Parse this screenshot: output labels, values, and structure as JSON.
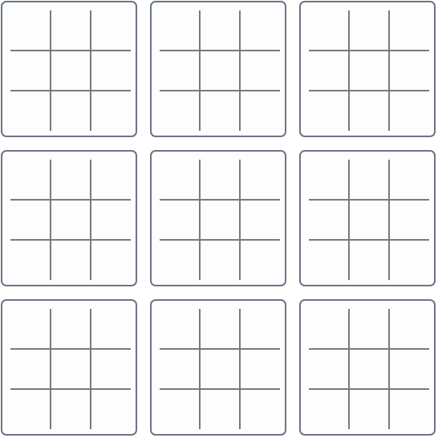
{
  "game": {
    "name": "",
    "boards": [
      {
        "cells": [
          "",
          "",
          "",
          "",
          "",
          "",
          "",
          "",
          ""
        ]
      },
      {
        "cells": [
          "",
          "",
          "",
          "",
          "",
          "",
          "",
          "",
          ""
        ]
      },
      {
        "cells": [
          "",
          "",
          "",
          "",
          "",
          "",
          "",
          "",
          ""
        ]
      },
      {
        "cells": [
          "",
          "",
          "",
          "",
          "",
          "",
          "",
          "",
          ""
        ]
      },
      {
        "cells": [
          "",
          "",
          "",
          "",
          "",
          "",
          "",
          "",
          ""
        ]
      },
      {
        "cells": [
          "",
          "",
          "",
          "",
          "",
          "",
          "",
          "",
          ""
        ]
      },
      {
        "cells": [
          "",
          "",
          "",
          "",
          "",
          "",
          "",
          "",
          ""
        ]
      },
      {
        "cells": [
          "",
          "",
          "",
          "",
          "",
          "",
          "",
          "",
          ""
        ]
      },
      {
        "cells": [
          "",
          "",
          "",
          "",
          "",
          "",
          "",
          "",
          ""
        ]
      }
    ]
  },
  "colors": {
    "board_border": "#6b7684",
    "grid_line": "#7a7a7a",
    "background": "#ffffff"
  }
}
